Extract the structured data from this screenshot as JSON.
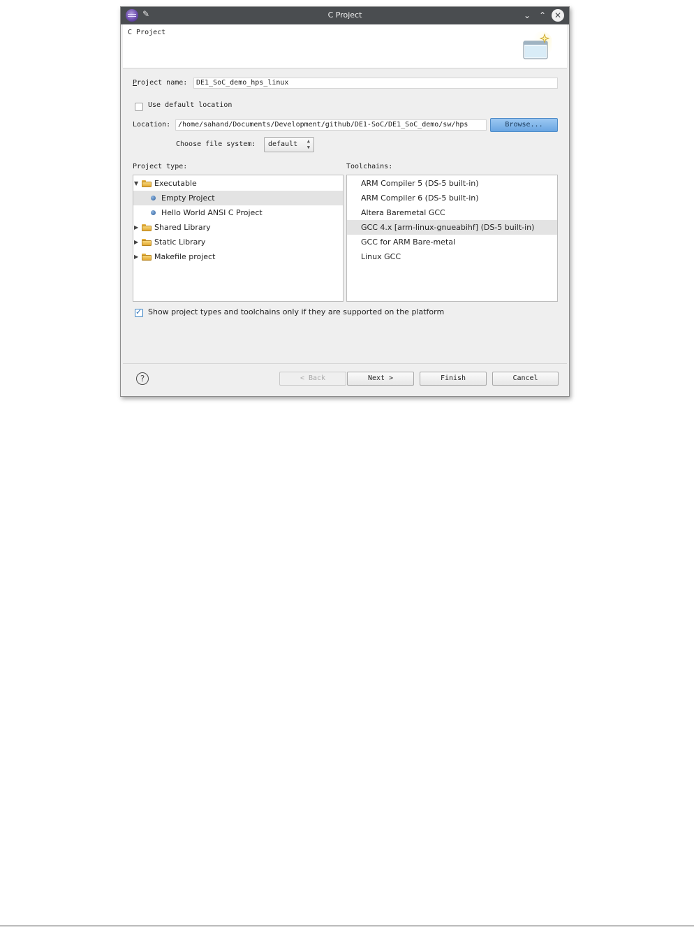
{
  "window": {
    "title": "C Project",
    "min_glyph": "⌄",
    "max_glyph": "⌃",
    "close_glyph": "✕",
    "pin_glyph": "✎"
  },
  "banner": {
    "title": "C Project"
  },
  "form": {
    "project_name_label": "Project name:",
    "project_name_value": "DE1_SoC_demo_hps_linux",
    "use_default_location_label": "Use default location",
    "use_default_location_checked": false,
    "location_label": "Location:",
    "location_value": "/home/sahand/Documents/Development/github/DE1-SoC/DE1_SoC_demo/sw/hps",
    "browse_label": "Browse...",
    "file_system_label": "Choose file system:",
    "file_system_value": "default"
  },
  "project_types": {
    "heading": "Project type:",
    "items": [
      {
        "label": "Executable",
        "kind": "folder",
        "expanded": true,
        "level": 0
      },
      {
        "label": "Empty Project",
        "kind": "leaf",
        "level": 1,
        "selected": true
      },
      {
        "label": "Hello World ANSI C Project",
        "kind": "leaf",
        "level": 1
      },
      {
        "label": "Shared Library",
        "kind": "folder",
        "expanded": false,
        "level": 0
      },
      {
        "label": "Static Library",
        "kind": "folder",
        "expanded": false,
        "level": 0
      },
      {
        "label": "Makefile project",
        "kind": "folder",
        "expanded": false,
        "level": 0
      }
    ]
  },
  "toolchains": {
    "heading": "Toolchains:",
    "items": [
      {
        "label": "ARM Compiler 5 (DS-5 built-in)"
      },
      {
        "label": "ARM Compiler 6 (DS-5 built-in)"
      },
      {
        "label": "Altera Baremetal GCC"
      },
      {
        "label": "GCC 4.x [arm-linux-gnueabihf] (DS-5 built-in)",
        "selected": true
      },
      {
        "label": "GCC for ARM Bare-metal"
      },
      {
        "label": "Linux GCC"
      }
    ]
  },
  "show_supported": {
    "label": "Show project types and toolchains only if they are supported on the platform",
    "checked": true
  },
  "buttons": {
    "help": "?",
    "back": "< Back",
    "next": "Next >",
    "finish": "Finish",
    "cancel": "Cancel"
  }
}
